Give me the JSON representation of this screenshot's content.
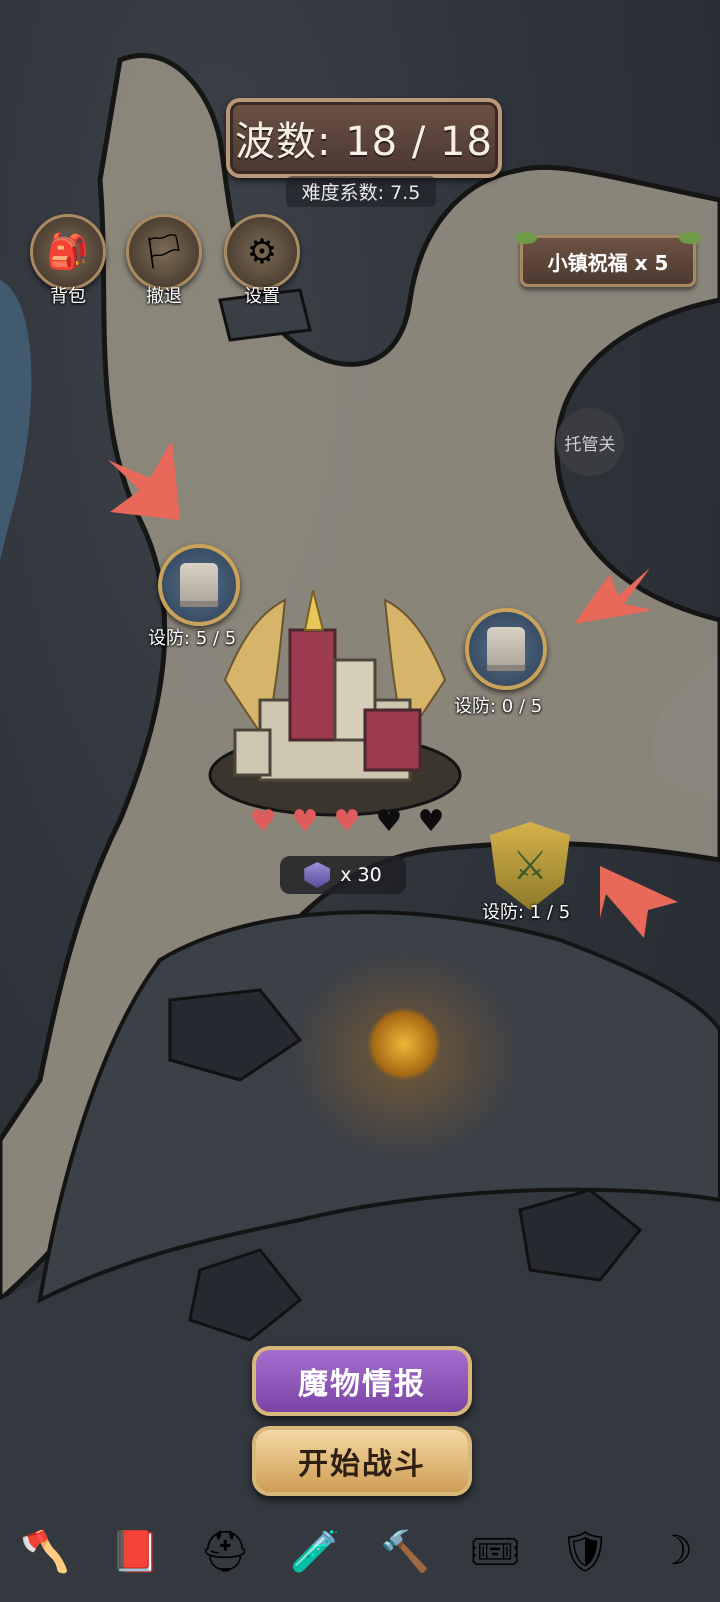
{
  "header": {
    "wave_label": "波数: 18 / 18",
    "difficulty_label": "难度系数: 7.5"
  },
  "top_buttons": [
    {
      "label": "背包",
      "icon": "backpack-icon"
    },
    {
      "label": "撤退",
      "icon": "retreat-flag-icon"
    },
    {
      "label": "设置",
      "icon": "gears-icon"
    }
  ],
  "blessing": {
    "label": "小镇祝福 x 5"
  },
  "auto_toggle": {
    "label": "托管关"
  },
  "defense_points": [
    {
      "label": "设防: 5 / 5",
      "icon": "tower-icon"
    },
    {
      "label": "设防: 0 / 5",
      "icon": "tower-icon"
    },
    {
      "label": "设防: 1 / 5",
      "icon": "crossed-swords-shield-icon"
    }
  ],
  "castle": {
    "hearts_full": 3,
    "hearts_total": 5,
    "crystal_count": "x 30"
  },
  "actions": {
    "monster_info": "魔物情报",
    "start_battle": "开始战斗"
  },
  "bottom_bar": [
    {
      "icon": "axe-icon"
    },
    {
      "icon": "red-book-icon"
    },
    {
      "icon": "winged-helmet-icon"
    },
    {
      "icon": "green-potion-icon"
    },
    {
      "icon": "hammer-icon"
    },
    {
      "icon": "golden-tickets-icon"
    },
    {
      "icon": "purple-shield-icon"
    },
    {
      "icon": "scythe-icon"
    }
  ],
  "colors": {
    "path": "#9a9587",
    "rock": "#2e3239",
    "water": "#4f6f8a",
    "arrow": "#ea6b54",
    "heart_full": "#e05c5c",
    "heart_empty": "#111111"
  }
}
